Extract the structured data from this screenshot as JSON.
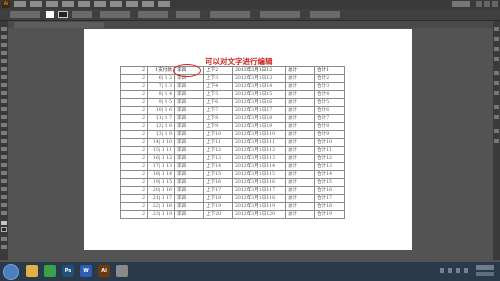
{
  "app": {
    "logo": "Ai"
  },
  "document": {
    "title": "可以对文字进行编辑",
    "table": {
      "rows": [
        [
          "2",
          "1支付款",
          "李四",
          "上下2",
          "2013年3月1日12",
          "总计",
          "合计1"
        ],
        [
          "2",
          "6| 1 3",
          "李四",
          "上下3",
          "2013年3月1日13",
          "总计",
          "合计2"
        ],
        [
          "2",
          "7| 1 3",
          "李四",
          "上下4",
          "2013年3月1日14",
          "总计",
          "合计3"
        ],
        [
          "2",
          "8| 1 4",
          "李四",
          "上下5",
          "2013年3月1日15",
          "总计",
          "合计4"
        ],
        [
          "2",
          "9| 1 5",
          "李四",
          "上下6",
          "2013年3月1日16",
          "总计",
          "合计5"
        ],
        [
          "2",
          "10| 1 6",
          "李四",
          "上下7",
          "2013年3月1日17",
          "总计",
          "合计6"
        ],
        [
          "2",
          "11| 1 7",
          "李四",
          "上下8",
          "2013年3月1日18",
          "总计",
          "合计7"
        ],
        [
          "2",
          "12| 1 8",
          "李四",
          "上下9",
          "2013年3月1日19",
          "总计",
          "合计8"
        ],
        [
          "2",
          "13| 1 9",
          "李四",
          "上下10",
          "2013年3月1日110",
          "总计",
          "合计9"
        ],
        [
          "2",
          "14| 1 10",
          "李四",
          "上下11",
          "2013年3月1日111",
          "总计",
          "合计10"
        ],
        [
          "2",
          "15| 1 11",
          "李四",
          "上下12",
          "2013年3月1日112",
          "总计",
          "合计11"
        ],
        [
          "2",
          "16| 1 12",
          "李四",
          "上下13",
          "2013年3月1日113",
          "总计",
          "合计12"
        ],
        [
          "2",
          "17| 1 13",
          "李四",
          "上下14",
          "2013年3月1日114",
          "总计",
          "合计13"
        ],
        [
          "2",
          "18| 1 14",
          "李四",
          "上下15",
          "2013年3月1日115",
          "总计",
          "合计14"
        ],
        [
          "2",
          "19| 1 15",
          "李四",
          "上下16",
          "2013年3月1日116",
          "总计",
          "合计15"
        ],
        [
          "2",
          "20| 1 16",
          "李四",
          "上下17",
          "2013年3月1日117",
          "总计",
          "合计16"
        ],
        [
          "2",
          "21| 1 17",
          "李四",
          "上下18",
          "2013年3月1日118",
          "总计",
          "合计17"
        ],
        [
          "2",
          "22| 1 18",
          "李四",
          "上下19",
          "2013年3月1日119",
          "总计",
          "合计18"
        ],
        [
          "2",
          "23| 1 19",
          "李四",
          "上下20",
          "2013年3月1日120",
          "总计",
          "合计19"
        ]
      ]
    }
  },
  "taskbar": {
    "icons": [
      {
        "name": "folder-icon",
        "label": "",
        "color": "#e0b04a"
      },
      {
        "name": "browser-icon",
        "label": "",
        "color": "#3aa04a"
      },
      {
        "name": "photoshop-icon",
        "label": "Ps",
        "color": "#1f4f7a"
      },
      {
        "name": "word-icon",
        "label": "W",
        "color": "#2b5fb4"
      },
      {
        "name": "illustrator-icon",
        "label": "Ai",
        "color": "#6b3b0f"
      },
      {
        "name": "app-icon",
        "label": "",
        "color": "#8a8a8a"
      }
    ]
  },
  "colors": {
    "title_red": "#c8261f",
    "ui_dark": "#535353",
    "circle_red": "#d9221c"
  }
}
